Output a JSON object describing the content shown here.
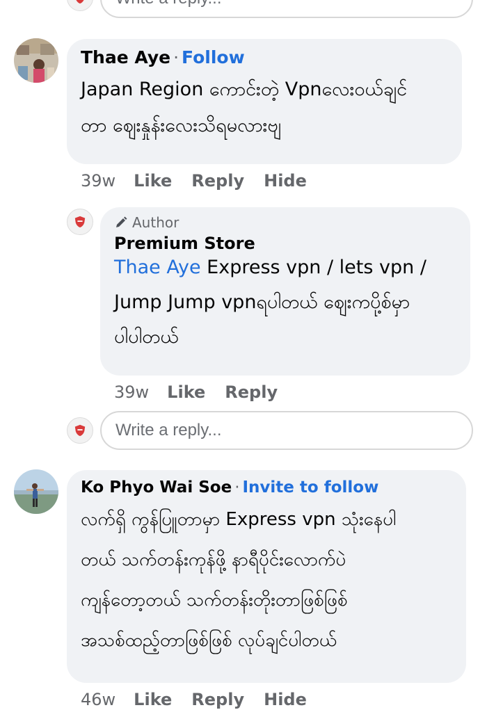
{
  "reply_box_placeholder": "Write a reply...",
  "comments": [
    {
      "author": "Thae Aye",
      "follow_label": "Follow",
      "lines": [
        "Japan Region ကောင်းတဲ့ Vpnလေးဝယ်ချင်",
        "တာ ဈေးနှုန်းလေးသိရမလားဗျ"
      ],
      "time": "39w",
      "actions": [
        "Like",
        "Reply",
        "Hide"
      ]
    },
    {
      "author_tag": "Author",
      "author": "Premium Store",
      "mention": "Thae Aye",
      "lines": [
        "Express vpn / lets vpn /",
        "Jump Jump vpnရပါတယ် ဈေးကပို့စ်မှာ",
        "ပါပါတယ်"
      ],
      "time": "39w",
      "actions": [
        "Like",
        "Reply"
      ]
    },
    {
      "author": "Ko Phyo Wai Soe",
      "follow_label": "Invite to follow",
      "lines": [
        "လက်ရှိ ကွန်ပြူတာမှာ Express vpn သုံးနေပါ",
        "တယ် သက်တန်းကုန်ဖို့ နာရီပိုင်းလောက်ပဲ",
        "ကျန်တော့တယ် သက်တန်းတိုးတာဖြစ်ဖြစ်",
        "အသစ်ထည့်တာဖြစ်ဖြစ် လုပ်ချင်ပါတယ်"
      ],
      "time": "46w",
      "actions": [
        "Like",
        "Reply",
        "Hide"
      ]
    }
  ],
  "colors": {
    "bubble": "#f0f2f5",
    "link": "#216fdb",
    "meta": "#65676b",
    "shield": "#d93a3a"
  },
  "icons": {
    "page_avatar": "red-shield-icon",
    "author_tag": "pencil-icon"
  }
}
